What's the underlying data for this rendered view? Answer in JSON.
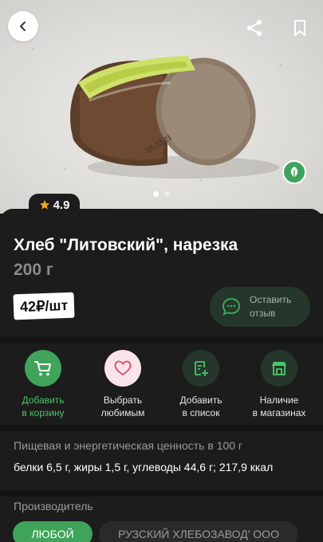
{
  "rating": {
    "value": "4.9"
  },
  "product": {
    "title": "Хлеб \"Литовский\", нарезка",
    "weight": "200 г",
    "price": "42₽/шт"
  },
  "review_button": {
    "label_line1": "Оставить",
    "label_line2": "отзыв"
  },
  "actions": [
    {
      "line1": "Добавить",
      "line2": "в корзину",
      "icon": "cart-icon"
    },
    {
      "line1": "Выбрать",
      "line2": "любимым",
      "icon": "heart-icon"
    },
    {
      "line1": "Добавить",
      "line2": "в список",
      "icon": "list-add-icon"
    },
    {
      "line1": "Наличие",
      "line2": "в магазинах",
      "icon": "store-icon"
    }
  ],
  "nutrition": {
    "heading": "Пищевая и энергетическая ценность в 100 г",
    "text": "белки 6,5 г, жиры 1,5 г, углеводы 44,6 г; 217,9 ккал"
  },
  "manufacturer": {
    "heading": "Производитель",
    "chips": [
      "ЛЮБОЙ",
      "РУЗСКИЙ ХЛЕБОЗАВОД' ООО"
    ]
  },
  "gallery": {
    "pages": 2,
    "active": 1
  },
  "colors": {
    "accent": "#3fa45a",
    "background": "#141414",
    "panel": "#1c1c1c",
    "rating_star": "#f5a524"
  }
}
